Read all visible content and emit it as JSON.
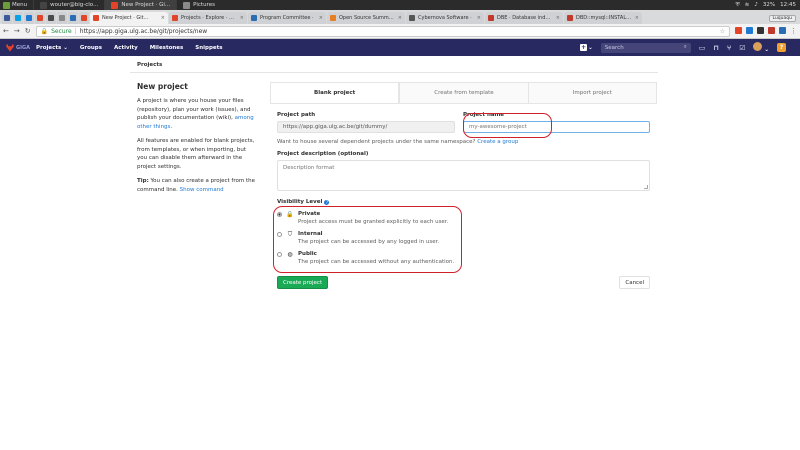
{
  "os": {
    "menu_label": "Menu",
    "tasks": [
      {
        "title": "wouter@big-clo...",
        "color": "#444444",
        "active": false
      },
      {
        "title": "New Project · Gi...",
        "color": "#e24329",
        "active": true
      },
      {
        "title": "Pictures",
        "color": "#8a8a8a",
        "active": false
      }
    ],
    "battery": "32%",
    "clock": "12:45"
  },
  "browser": {
    "pinned_colors": [
      "#3b5998",
      "#0aa1e5",
      "#1f78d1",
      "#e24329",
      "#4a4a4a",
      "#888888",
      "#2a6db5",
      "#e24329"
    ],
    "tabs": [
      {
        "title": "New Project · Git...",
        "color": "#e24329",
        "active": true
      },
      {
        "title": "Projects · Explore · Git...",
        "color": "#e24329",
        "active": false
      },
      {
        "title": "Program Committee ·",
        "color": "#2a6db5",
        "active": false
      },
      {
        "title": "Open Source Summit |",
        "color": "#e67e22",
        "active": false
      },
      {
        "title": "Cybernova Software · ",
        "color": "#555555",
        "active": false
      },
      {
        "title": "DBE · Database indepe",
        "color": "#c0392b",
        "active": false
      },
      {
        "title": "DBD::mysql::INSTALL ·",
        "color": "#c0392b",
        "active": false
      }
    ],
    "tab_close": "×",
    "right_button": "Luquaqu",
    "secure_label": "Secure",
    "url": "https://app.giga.ulg.ac.be/git/projects/new"
  },
  "navbar": {
    "brand": "GIGA",
    "items": [
      "Projects",
      "Groups",
      "Activity",
      "Milestones",
      "Snippets"
    ],
    "search_placeholder": "Search"
  },
  "breadcrumb": "Projects",
  "sidebar": {
    "title": "New project",
    "intro_before": "A project is where you house your files (repository), plan your work (issues), and publish your documentation (wiki), ",
    "intro_link": "among other things",
    "intro_after": ".",
    "features": "All features are enabled for blank projects, from templates, or when importing, but you can disable them afterward in the project settings.",
    "tip_label": "Tip:",
    "tip_text": " You can also create a project from the command line. ",
    "tip_link": "Show command"
  },
  "tabs": [
    "Blank project",
    "Create from template",
    "Import project"
  ],
  "form": {
    "path_label": "Project path",
    "path_value": "https://app.giga.ulg.ac.be/git/dummy/",
    "name_label": "Project name",
    "name_placeholder": "my-awesome-project",
    "namespace_hint": "Want to house several dependent projects under the same namespace? ",
    "namespace_link": "Create a group",
    "desc_label": "Project description (optional)",
    "desc_placeholder": "Description format",
    "visibility_label": "Visibility Level",
    "visibility": [
      {
        "title": "Private",
        "desc": "Project access must be granted explicitly to each user.",
        "checked": true,
        "icon": "lock-icon"
      },
      {
        "title": "Internal",
        "desc": "The project can be accessed by any logged in user.",
        "checked": false,
        "icon": "shield-icon"
      },
      {
        "title": "Public",
        "desc": "The project can be accessed without any authentication.",
        "checked": false,
        "icon": "globe-icon"
      }
    ],
    "create_label": "Create project",
    "cancel_label": "Cancel"
  }
}
